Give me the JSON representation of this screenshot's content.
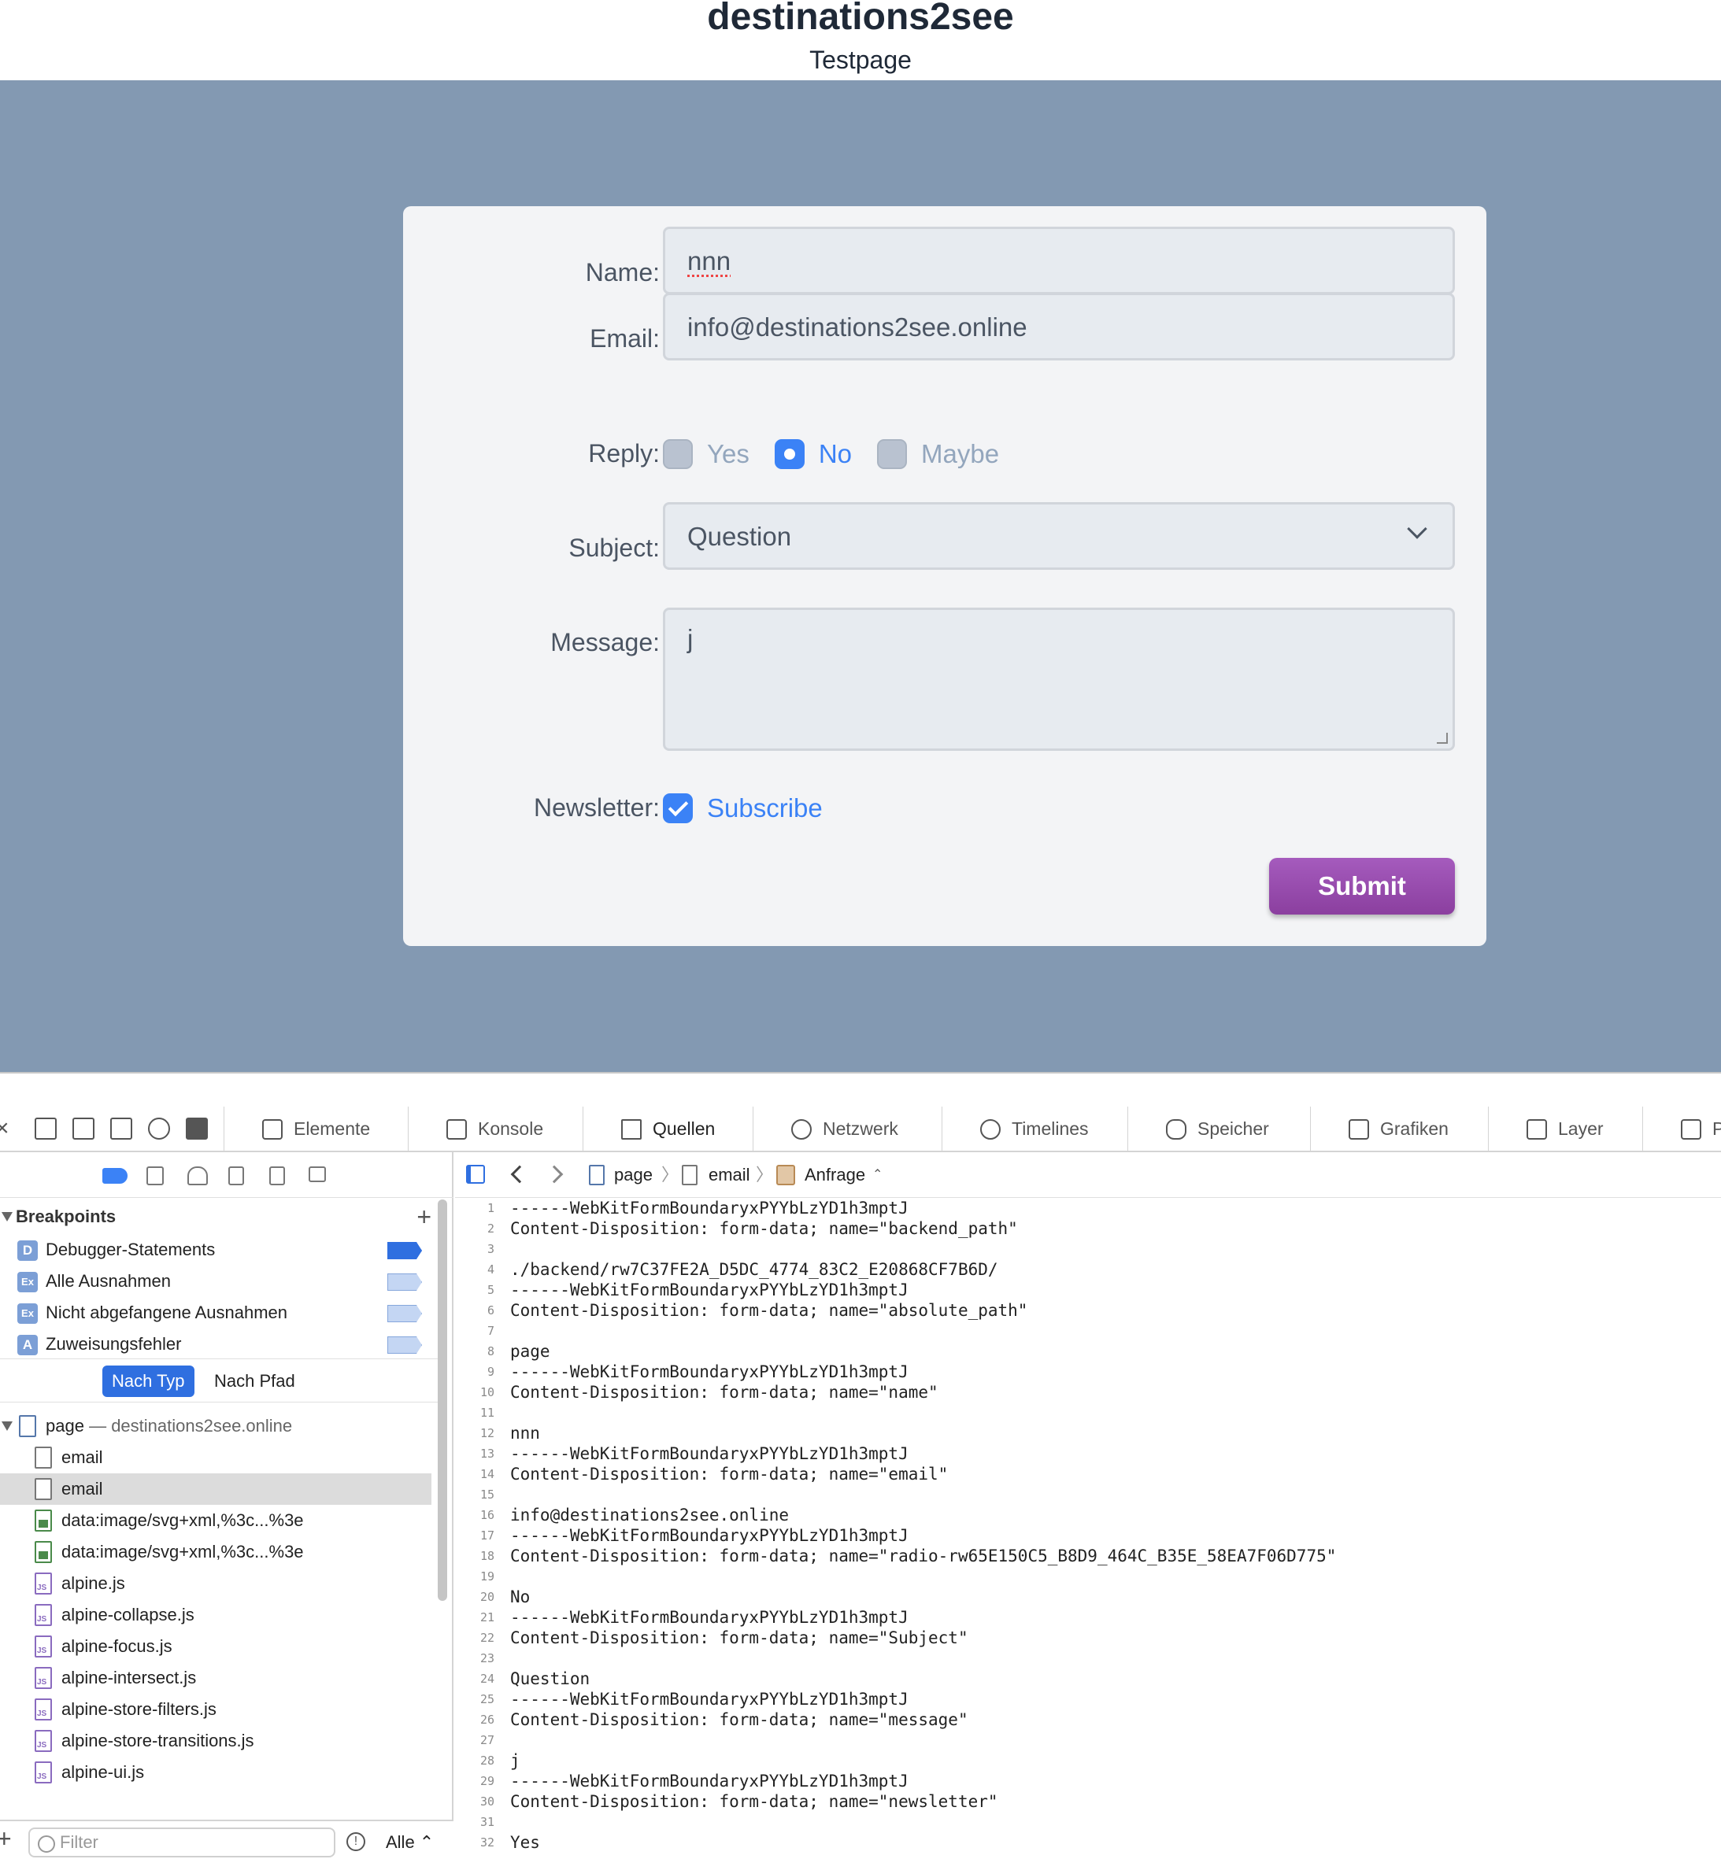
{
  "site": {
    "title": "destinations2see",
    "subtitle": "Testpage"
  },
  "form": {
    "name_label": "Name:",
    "name_value": "nnn",
    "email_label": "Email:",
    "email_value": "info@destinations2see.online",
    "reply_label": "Reply:",
    "reply_options": [
      "Yes",
      "No",
      "Maybe"
    ],
    "reply_selected": "No",
    "subject_label": "Subject:",
    "subject_value": "Question",
    "message_label": "Message:",
    "message_value": "j",
    "newsletter_label": "Newsletter:",
    "newsletter_option": "Subscribe",
    "newsletter_checked": true,
    "submit_label": "Submit"
  },
  "colors": {
    "page_bg": "#8399b2",
    "accent": "#3b82f6",
    "submit": "#9b4eb3"
  },
  "devtools": {
    "tabs": [
      "Elemente",
      "Konsole",
      "Quellen",
      "Netzwerk",
      "Timelines",
      "Speicher",
      "Grafiken",
      "Layer",
      "P"
    ],
    "active_tab": "Quellen",
    "breakpoints_title": "Breakpoints",
    "breakpoints": [
      {
        "badge": "D",
        "label": "Debugger-Statements",
        "enabled": true
      },
      {
        "badge": "Ex",
        "label": "Alle Ausnahmen",
        "enabled": false
      },
      {
        "badge": "Ex",
        "label": "Nicht abgefangene Ausnahmen",
        "enabled": false
      },
      {
        "badge": "A",
        "label": "Zuweisungsfehler",
        "enabled": false
      }
    ],
    "group_by": [
      "Nach Typ",
      "Nach Pfad"
    ],
    "resource_root": {
      "name": "page",
      "host": "— destinations2see.online"
    },
    "resources": [
      {
        "name": "email",
        "kind": "doc"
      },
      {
        "name": "email",
        "kind": "doc",
        "selected": true
      },
      {
        "name": "data:image/svg+xml,%3c...%3e",
        "kind": "img"
      },
      {
        "name": "data:image/svg+xml,%3c...%3e",
        "kind": "img"
      },
      {
        "name": "alpine.js",
        "kind": "js"
      },
      {
        "name": "alpine-collapse.js",
        "kind": "js"
      },
      {
        "name": "alpine-focus.js",
        "kind": "js"
      },
      {
        "name": "alpine-intersect.js",
        "kind": "js"
      },
      {
        "name": "alpine-store-filters.js",
        "kind": "js"
      },
      {
        "name": "alpine-store-transitions.js",
        "kind": "js"
      },
      {
        "name": "alpine-ui.js",
        "kind": "js"
      }
    ],
    "filter_placeholder": "Filter",
    "filter_scope": "Alle ⌃",
    "breadcrumb": [
      "page",
      "email",
      "Anfrage"
    ],
    "code_lines": [
      "------WebKitFormBoundaryxPYYbLzYD1h3mptJ",
      "Content-Disposition: form-data; name=\"backend_path\"",
      "",
      "./backend/rw7C37FE2A_D5DC_4774_83C2_E20868CF7B6D/",
      "------WebKitFormBoundaryxPYYbLzYD1h3mptJ",
      "Content-Disposition: form-data; name=\"absolute_path\"",
      "",
      "page",
      "------WebKitFormBoundaryxPYYbLzYD1h3mptJ",
      "Content-Disposition: form-data; name=\"name\"",
      "",
      "nnn",
      "------WebKitFormBoundaryxPYYbLzYD1h3mptJ",
      "Content-Disposition: form-data; name=\"email\"",
      "",
      "info@destinations2see.online",
      "------WebKitFormBoundaryxPYYbLzYD1h3mptJ",
      "Content-Disposition: form-data; name=\"radio-rw65E150C5_B8D9_464C_B35E_58EA7F06D775\"",
      "",
      "No",
      "------WebKitFormBoundaryxPYYbLzYD1h3mptJ",
      "Content-Disposition: form-data; name=\"Subject\"",
      "",
      "Question",
      "------WebKitFormBoundaryxPYYbLzYD1h3mptJ",
      "Content-Disposition: form-data; name=\"message\"",
      "",
      "j",
      "------WebKitFormBoundaryxPYYbLzYD1h3mptJ",
      "Content-Disposition: form-data; name=\"newsletter\"",
      "",
      "Yes"
    ]
  }
}
